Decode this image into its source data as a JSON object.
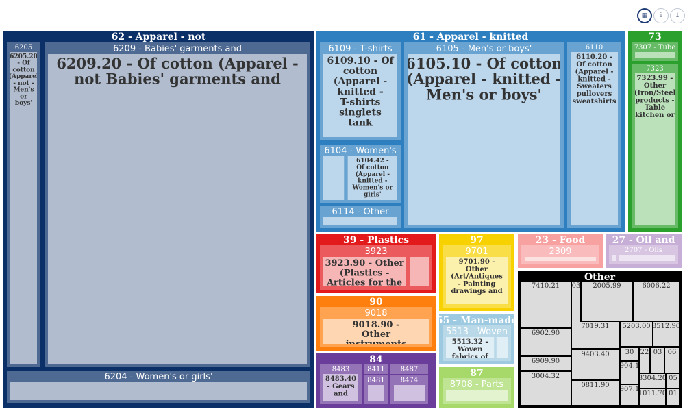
{
  "toolbar": {
    "buttons": [
      {
        "name": "qr-icon",
        "glyph": "▦",
        "active": true
      },
      {
        "name": "info-icon",
        "glyph": "i",
        "active": false
      },
      {
        "name": "download-icon",
        "glyph": "⤓",
        "active": false
      }
    ]
  },
  "chart_data": {
    "type": "treemap",
    "groups": [
      {
        "label": "62 - Apparel - not",
        "color": "#0b3068",
        "children": [
          {
            "label": "6205",
            "leaf": "6205.20 - Of cotton (Apparel - not - Men's or boys'"
          },
          {
            "label": "6209 - Babies' garments and",
            "leaf": "6209.20 - Of cotton (Apparel - not Babies' garments and"
          },
          {
            "label": "6204 - Women's or girls'",
            "leaf": ""
          }
        ]
      },
      {
        "label": "61 - Apparel - knitted",
        "color": "#2d7fbf",
        "children": [
          {
            "label": "6109 - T-shirts",
            "leaf": "6109.10 - Of cotton (Apparel - knitted - T-shirts singlets tank"
          },
          {
            "label": "6105 - Men's or boys'",
            "leaf": "6105.10 - Of cotton (Apparel - knitted - Men's or boys'"
          },
          {
            "label": "6110",
            "leaf": "6110.20 - Of cotton (Apparel - knitted - Sweaters pullovers sweatshirts"
          },
          {
            "label": "6104 - Women's",
            "leaf": "6104.42 - Of cotton (Apparel - knitted - Women's or girls'"
          },
          {
            "label": "6114 - Other",
            "leaf": ""
          }
        ]
      },
      {
        "label": "73",
        "color": "#2ca02c",
        "children": [
          {
            "label": "7307 - Tube",
            "leaf": ""
          },
          {
            "label": "7323",
            "leaf": "7323.99 - Other (Iron/Steel products - Table kitchen or"
          }
        ]
      },
      {
        "label": "39 - Plastics",
        "color": "#e31a1c",
        "children": [
          {
            "label": "3923",
            "leaf": "3923.90 - Other (Plastics - Articles for the"
          }
        ]
      },
      {
        "label": "97",
        "color": "#f7d100",
        "children": [
          {
            "label": "9701",
            "leaf": "9701.90 - Other (Art/Antiques - Painting drawings and"
          }
        ]
      },
      {
        "label": "23 - Food",
        "color": "#f7a1a1",
        "children": [
          {
            "label": "2309",
            "leaf": ""
          }
        ]
      },
      {
        "label": "27 - Oil and",
        "color": "#c7aed6",
        "children": [
          {
            "label": "2707 - Oils",
            "leaf": ""
          }
        ]
      },
      {
        "label": "90",
        "color": "#ff7f0e",
        "children": [
          {
            "label": "9018",
            "leaf": "9018.90 - Other instruments"
          }
        ]
      },
      {
        "label": "55 - Man-made",
        "color": "#9ecae1",
        "children": [
          {
            "label": "5513 - Woven",
            "leaf": "5513.32 - Woven fabrics of"
          }
        ]
      },
      {
        "label": "84",
        "color": "#6a3d9a",
        "children": [
          {
            "label": "8483",
            "leaf": "8483.40 - Gears and"
          },
          {
            "label": "8411",
            "leaf": ""
          },
          {
            "label": "8487",
            "leaf": ""
          },
          {
            "label": "8481",
            "leaf": ""
          },
          {
            "label": "8474",
            "leaf": ""
          }
        ]
      },
      {
        "label": "87",
        "color": "#a6d96a",
        "children": [
          {
            "label": "8708 - Parts",
            "leaf": ""
          }
        ]
      },
      {
        "label": "Other",
        "color": "#000000",
        "children": [
          {
            "label": "7410.21"
          },
          {
            "label": "03"
          },
          {
            "label": "2005.99"
          },
          {
            "label": "6006.22"
          },
          {
            "label": "7019.31"
          },
          {
            "label": "5203.00"
          },
          {
            "label": "8512.90"
          },
          {
            "label": "6902.90"
          },
          {
            "label": "9403.40"
          },
          {
            "label": "30"
          },
          {
            "label": "22"
          },
          {
            "label": "03"
          },
          {
            "label": "06"
          },
          {
            "label": "6909.90"
          },
          {
            "label": "904.1"
          },
          {
            "label": "3004.32"
          },
          {
            "label": "3304.20"
          },
          {
            "label": "05"
          },
          {
            "label": "0811.90"
          },
          {
            "label": "907.1"
          },
          {
            "label": "1011.70"
          },
          {
            "label": "01"
          }
        ]
      }
    ]
  }
}
